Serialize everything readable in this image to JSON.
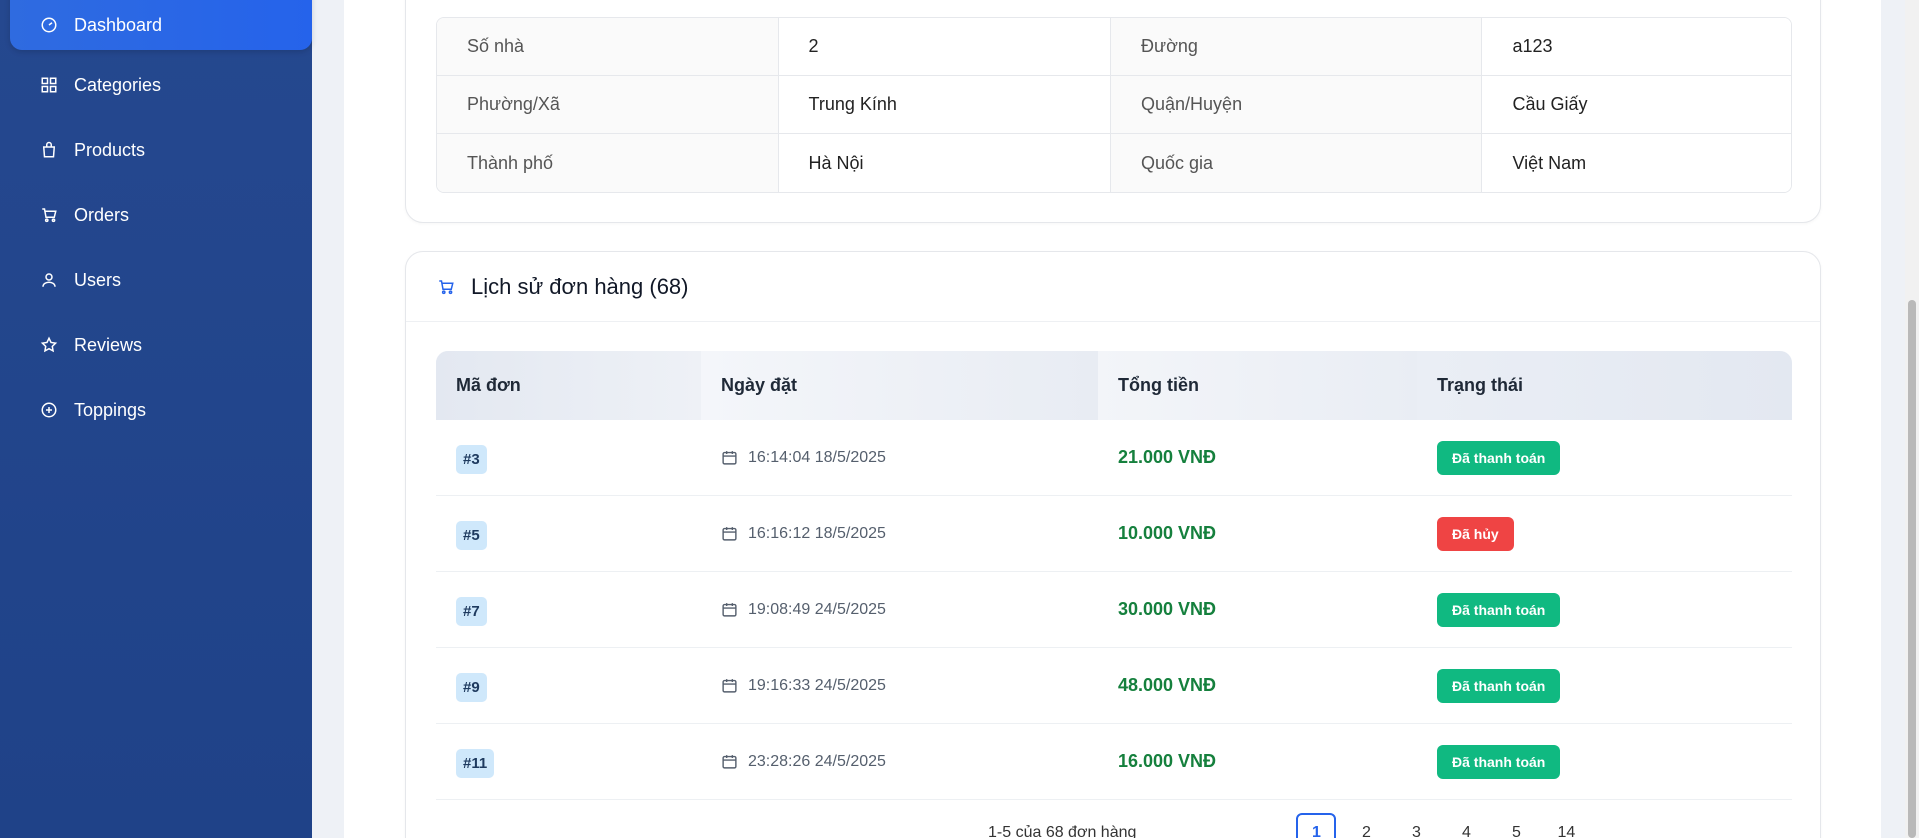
{
  "sidebar": {
    "items": [
      {
        "label": "Dashboard",
        "icon": "gauge-icon",
        "active": true
      },
      {
        "label": "Categories",
        "icon": "grid-icon"
      },
      {
        "label": "Products",
        "icon": "shopping-bag-icon"
      },
      {
        "label": "Orders",
        "icon": "cart-icon"
      },
      {
        "label": "Users",
        "icon": "user-icon"
      },
      {
        "label": "Reviews",
        "icon": "star-icon"
      },
      {
        "label": "Toppings",
        "icon": "plus-circle-icon"
      }
    ]
  },
  "address": {
    "rows": [
      {
        "label1": "Số nhà",
        "value1": "2",
        "label2": "Đường",
        "value2": "a123"
      },
      {
        "label1": "Phường/Xã",
        "value1": "Trung Kính",
        "label2": "Quận/Huyện",
        "value2": "Cầu Giấy"
      },
      {
        "label1": "Thành phố",
        "value1": "Hà Nội",
        "label2": "Quốc gia",
        "value2": "Việt Nam"
      }
    ]
  },
  "orders": {
    "title": "Lịch sử đơn hàng (68)",
    "headers": [
      "Mã đơn",
      "Ngày đặt",
      "Tổng tiền",
      "Trạng thái"
    ],
    "rows": [
      {
        "id": "#3",
        "date": "16:14:04 18/5/2025",
        "amount": "21.000 VNĐ",
        "status": "Đã thanh toán",
        "status_type": "paid"
      },
      {
        "id": "#5",
        "date": "16:16:12 18/5/2025",
        "amount": "10.000 VNĐ",
        "status": "Đã hủy",
        "status_type": "cancel"
      },
      {
        "id": "#7",
        "date": "19:08:49 24/5/2025",
        "amount": "30.000 VNĐ",
        "status": "Đã thanh toán",
        "status_type": "paid"
      },
      {
        "id": "#9",
        "date": "19:16:33 24/5/2025",
        "amount": "48.000 VNĐ",
        "status": "Đã thanh toán",
        "status_type": "paid"
      },
      {
        "id": "#11",
        "date": "23:28:26 24/5/2025",
        "amount": "16.000 VNĐ",
        "status": "Đã thanh toán",
        "status_type": "paid"
      }
    ]
  },
  "pagination": {
    "info": "1-5 của 68 đơn hàng",
    "pages": [
      "1",
      "2",
      "3",
      "4",
      "5",
      "14"
    ],
    "current": "1"
  },
  "colors": {
    "sidebar_bg": "#1f4288",
    "accent": "#2563eb",
    "paid": "#10b981",
    "cancel": "#ef4444",
    "amount": "#15803d"
  }
}
